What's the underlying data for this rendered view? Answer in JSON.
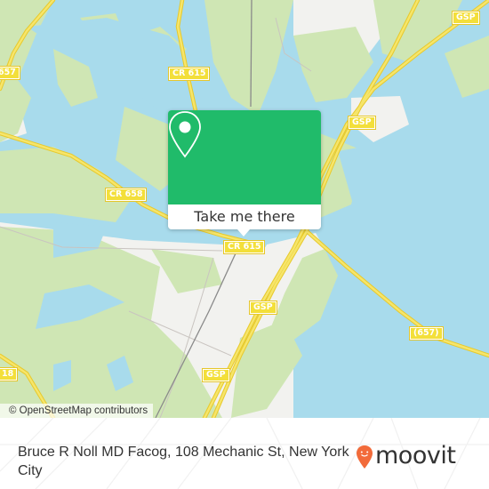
{
  "map": {
    "road_labels": [
      {
        "id": "cr615-north",
        "text": "CR 615"
      },
      {
        "id": "cr658",
        "text": "CR 658"
      },
      {
        "id": "cr615-center",
        "text": "CR 615"
      },
      {
        "id": "gsp-ne",
        "text": "GSP"
      },
      {
        "id": "gsp-mid",
        "text": "GSP"
      },
      {
        "id": "gsp-south",
        "text": "GSP"
      },
      {
        "id": "gsp-south2",
        "text": "GSP"
      },
      {
        "id": "r657",
        "text": "(657)"
      },
      {
        "id": "r657-west",
        "text": "657"
      },
      {
        "id": "r618",
        "text": "18"
      }
    ],
    "attribution": "© OpenStreetMap contributors",
    "colors": {
      "water": "#a8dbec",
      "land": "#f2f2ef",
      "forest": "#cfe6b4",
      "road": "#f3df3a",
      "popup": "#20bb6a"
    }
  },
  "popup": {
    "icon": "map-pin-icon",
    "button_label": "Take me there"
  },
  "footer": {
    "address": "Bruce R Noll MD Facog, 108 Mechanic St, New York City",
    "brand": "moovit",
    "brand_color": "#f26b3a"
  }
}
